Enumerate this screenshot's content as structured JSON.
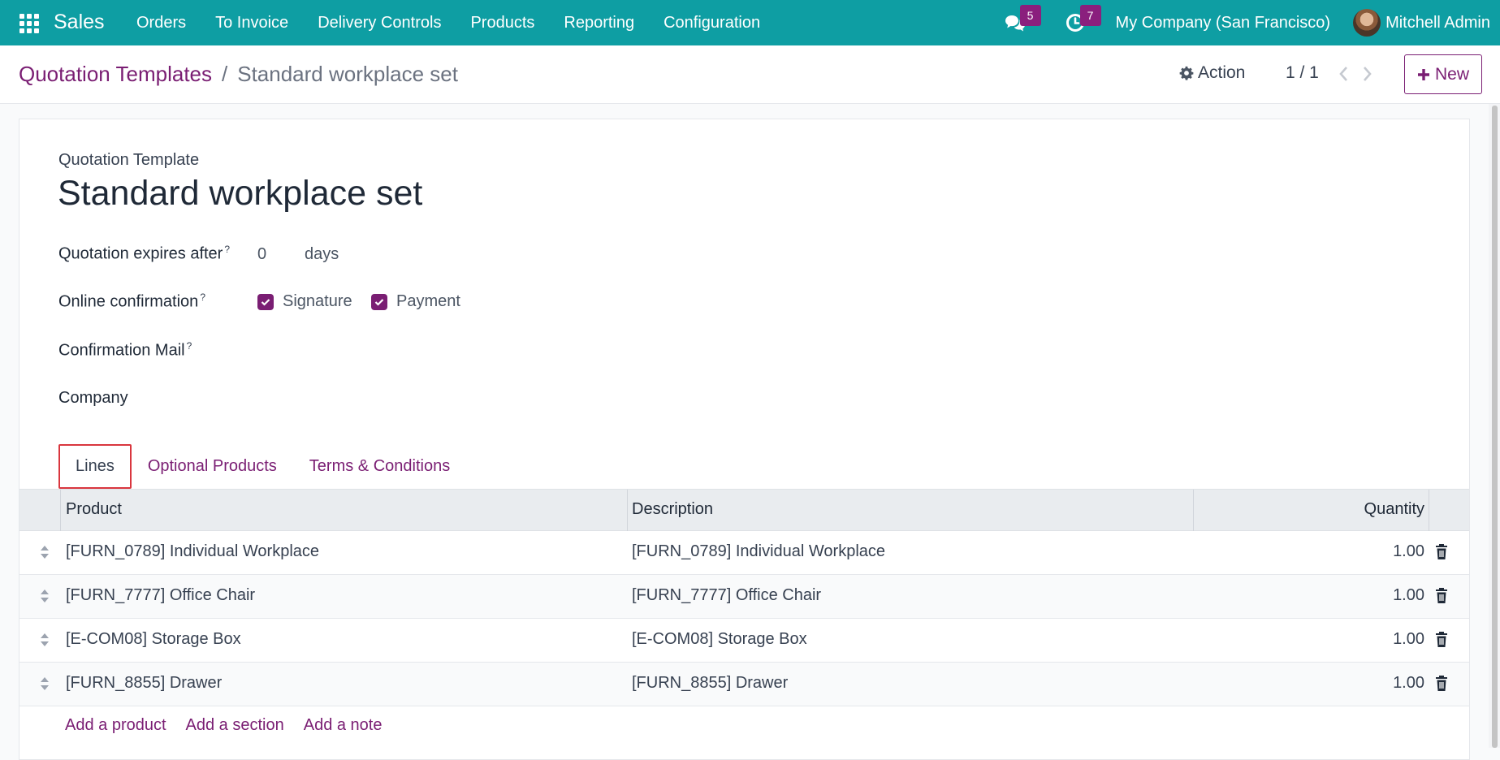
{
  "topnav": {
    "app_name": "Sales",
    "menu": [
      "Orders",
      "To Invoice",
      "Delivery Controls",
      "Products",
      "Reporting",
      "Configuration"
    ],
    "messages_count": "5",
    "activities_count": "7",
    "company": "My Company (San Francisco)",
    "user": "Mitchell Admin"
  },
  "controlbar": {
    "breadcrumb_parent": "Quotation Templates",
    "breadcrumb_separator": "/",
    "breadcrumb_current": "Standard workplace set",
    "action_label": "Action",
    "pager": "1 / 1",
    "new_label": "New"
  },
  "form": {
    "subtitle": "Quotation Template",
    "title": "Standard workplace set",
    "expires_label": "Quotation expires after",
    "expires_value": "0",
    "expires_unit": "days",
    "online_label": "Online confirmation",
    "signature_label": "Signature",
    "payment_label": "Payment",
    "mail_label": "Confirmation Mail",
    "company_label": "Company",
    "help_mark": "?"
  },
  "tabs": [
    "Lines",
    "Optional Products",
    "Terms & Conditions"
  ],
  "table": {
    "columns": {
      "product": "Product",
      "description": "Description",
      "quantity": "Quantity"
    },
    "rows": [
      {
        "product": "[FURN_0789] Individual Workplace",
        "description": "[FURN_0789] Individual Workplace",
        "quantity": "1.00"
      },
      {
        "product": "[FURN_7777] Office Chair",
        "description": "[FURN_7777] Office Chair",
        "quantity": "1.00"
      },
      {
        "product": "[E-COM08] Storage Box",
        "description": "[E-COM08] Storage Box",
        "quantity": "1.00"
      },
      {
        "product": "[FURN_8855] Drawer",
        "description": "[FURN_8855] Drawer",
        "quantity": "1.00"
      }
    ],
    "add_links": [
      "Add a product",
      "Add a section",
      "Add a note"
    ]
  },
  "colors": {
    "topbar": "#0e9ea3",
    "accent": "#7a1e73",
    "badge": "#8a1f7d"
  }
}
